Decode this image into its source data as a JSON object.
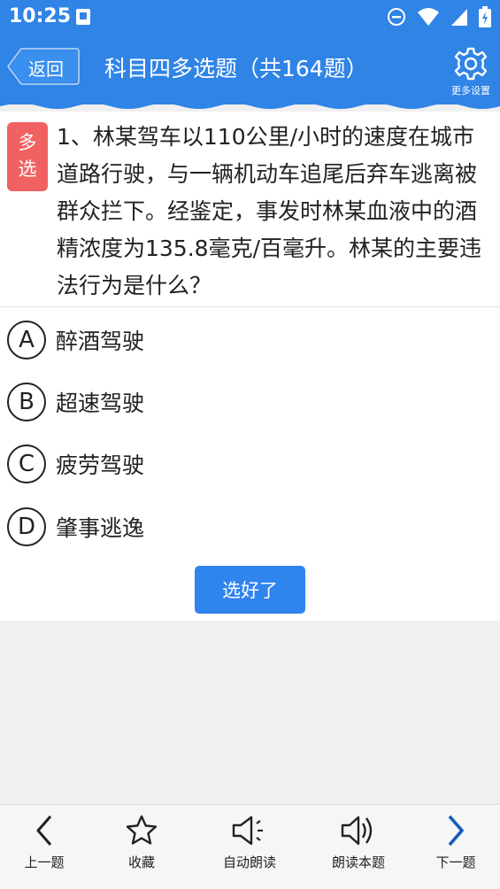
{
  "status_bar": {
    "time": "10:25"
  },
  "header": {
    "back_label": "返回",
    "title": "科目四多选题（共164题）",
    "settings_label": "更多设置"
  },
  "question": {
    "type_badge_line1": "多",
    "type_badge_line2": "选",
    "text": "1、林某驾车以110公里/小时的速度在城市道路行驶，与一辆机动车追尾后弃车逃离被群众拦下。经鉴定，事发时林某血液中的酒精浓度为135.8毫克/百毫升。林某的主要违法行为是什么？"
  },
  "options": [
    {
      "letter": "A",
      "text": "醉酒驾驶"
    },
    {
      "letter": "B",
      "text": "超速驾驶"
    },
    {
      "letter": "C",
      "text": "疲劳驾驶"
    },
    {
      "letter": "D",
      "text": "肇事逃逸"
    }
  ],
  "confirm_label": "选好了",
  "bottom_nav": [
    {
      "label": "上一题",
      "icon": "chevron-left-icon"
    },
    {
      "label": "收藏",
      "icon": "star-icon"
    },
    {
      "label": "自动朗读",
      "icon": "speaker-icon"
    },
    {
      "label": "朗读本题",
      "icon": "speaker-wave-icon"
    },
    {
      "label": "下一题",
      "icon": "chevron-right-icon"
    }
  ],
  "colors": {
    "primary": "#2f84e6",
    "badge": "#f06262",
    "button": "#2f84ee"
  }
}
